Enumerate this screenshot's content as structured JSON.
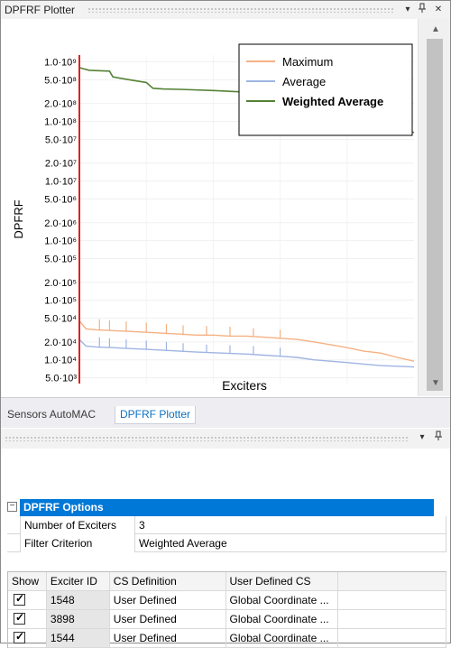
{
  "top_panel": {
    "title": "DPFRF Plotter",
    "icons": [
      "dropdown-icon",
      "pin-icon",
      "close-icon"
    ]
  },
  "chart_data": {
    "type": "line",
    "ylabel": "DPFRF",
    "xlabel": "Exciters",
    "yscale": "log",
    "ylim": [
      4000,
      1300000000
    ],
    "x_range": [
      0,
      100
    ],
    "y_tick_labels": [
      "1.0·10⁹",
      "5.0·10⁸",
      "2.0·10⁸",
      "1.0·10⁸",
      "5.0·10⁷",
      "2.0·10⁷",
      "1.0·10⁷",
      "5.0·10⁶",
      "2.0·10⁶",
      "1.0·10⁶",
      "5.0·10⁵",
      "2.0·10⁵",
      "1.0·10⁵",
      "5.0·10⁴",
      "2.0·10⁴",
      "1.0·10⁴",
      "5.0·10³"
    ],
    "y_tick_values": [
      1000000000.0,
      500000000.0,
      200000000.0,
      100000000.0,
      50000000.0,
      20000000.0,
      10000000.0,
      5000000.0,
      2000000.0,
      1000000.0,
      500000.0,
      200000.0,
      100000.0,
      50000.0,
      20000.0,
      10000.0,
      5000.0
    ],
    "legend_position": "top-right",
    "series": [
      {
        "name": "Maximum",
        "color": "#f4b183",
        "x": [
          0,
          2,
          5,
          10,
          15,
          20,
          25,
          30,
          35,
          40,
          45,
          50,
          55,
          60,
          65,
          70,
          75,
          80,
          85,
          90,
          95,
          100
        ],
        "y": [
          45000,
          33000,
          32000,
          31000,
          30000,
          29000,
          28000,
          27000,
          26000,
          26000,
          25000,
          25000,
          24000,
          23000,
          22000,
          20000,
          18000,
          16000,
          14000,
          13000,
          11000,
          9500
        ],
        "spikes": [
          [
            6,
            48000
          ],
          [
            9,
            46000
          ],
          [
            14,
            44000
          ],
          [
            20,
            42000
          ],
          [
            26,
            40000
          ],
          [
            31,
            38000
          ],
          [
            38,
            37000
          ],
          [
            45,
            36000
          ],
          [
            52,
            34000
          ],
          [
            60,
            32000
          ]
        ]
      },
      {
        "name": "Average",
        "color": "#9fb4e3",
        "x": [
          0,
          2,
          5,
          10,
          15,
          20,
          25,
          30,
          35,
          40,
          45,
          50,
          55,
          60,
          65,
          70,
          75,
          80,
          85,
          90,
          95,
          100
        ],
        "y": [
          22000,
          17000,
          16500,
          16000,
          15500,
          15000,
          14500,
          14000,
          13500,
          13200,
          12800,
          12500,
          12000,
          11500,
          11000,
          10000,
          9500,
          9000,
          8500,
          8000,
          7800,
          7600
        ],
        "spikes": [
          [
            6,
            24000
          ],
          [
            9,
            23000
          ],
          [
            14,
            22000
          ],
          [
            20,
            21000
          ],
          [
            26,
            20000
          ],
          [
            31,
            19000
          ],
          [
            38,
            18000
          ],
          [
            45,
            17500
          ],
          [
            52,
            17000
          ],
          [
            60,
            16000
          ]
        ]
      },
      {
        "name": "Weighted Average",
        "color": "#548235",
        "bold": true,
        "x": [
          0,
          1,
          3,
          9,
          10,
          15,
          20,
          22,
          25,
          30,
          40,
          50,
          60,
          70,
          75,
          80,
          85,
          88,
          90,
          95,
          100
        ],
        "y": [
          800000000,
          770000000,
          720000000,
          700000000,
          560000000,
          500000000,
          450000000,
          360000000,
          350000000,
          345000000,
          330000000,
          310000000,
          290000000,
          270000000,
          260000000,
          230000000,
          180000000,
          130000000,
          110000000,
          80000000,
          65000000
        ]
      }
    ],
    "marker_line": {
      "x": 0,
      "color": "#e02020"
    }
  },
  "tabs": [
    {
      "label": "Sensors AutoMAC",
      "active": false
    },
    {
      "label": "DPFRF Plotter",
      "active": true
    }
  ],
  "bottom_panel": {
    "icons": [
      "dropdown-icon",
      "pin-icon"
    ]
  },
  "options": {
    "title": "DPFRF Options",
    "collapse_glyph": "−",
    "rows": [
      {
        "key": "Number of Exciters",
        "value": "3"
      },
      {
        "key": "Filter Criterion",
        "value": "Weighted Average"
      }
    ]
  },
  "table": {
    "headers": [
      "Show",
      "Exciter ID",
      "CS Definition",
      "User Defined CS"
    ],
    "rows": [
      {
        "show": true,
        "id": "1548",
        "cs": "User Defined",
        "ucs": "Global Coordinate ..."
      },
      {
        "show": true,
        "id": "3898",
        "cs": "User Defined",
        "ucs": "Global Coordinate ..."
      },
      {
        "show": true,
        "id": "1544",
        "cs": "User Defined",
        "ucs": "Global Coordinate ..."
      }
    ]
  }
}
